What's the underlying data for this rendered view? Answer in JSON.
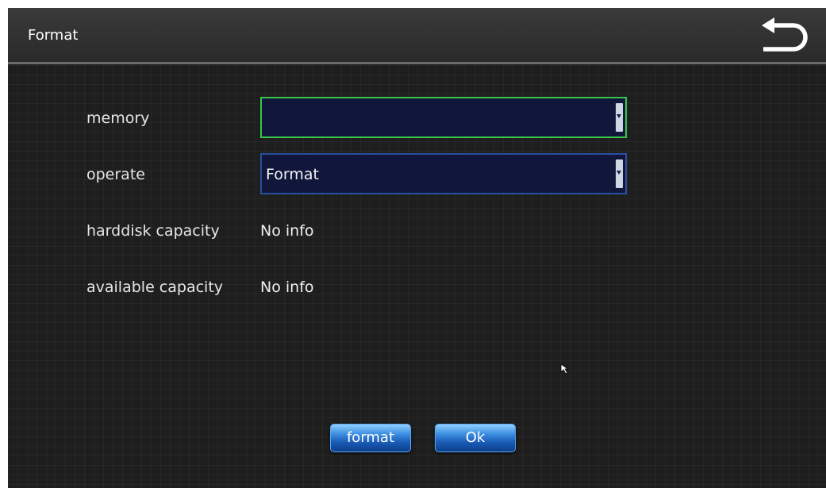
{
  "header": {
    "title": "Format"
  },
  "form": {
    "memory": {
      "label": "memory",
      "value": ""
    },
    "operate": {
      "label": "operate",
      "value": "Format"
    },
    "harddisk_capacity": {
      "label": "harddisk capacity",
      "value": "No info"
    },
    "available_capacity": {
      "label": "available capacity",
      "value": "No info"
    }
  },
  "buttons": {
    "format_label": "format",
    "ok_label": "Ok"
  },
  "icons": {
    "back": "back-arrow-icon",
    "dropdown": "chevron-down-icon",
    "cursor": "mouse-cursor-icon"
  },
  "colors": {
    "focus_border": "#38c64a",
    "select_border": "#2a4f9e",
    "select_bg": "#10173a",
    "button_blue": "#1a5cb8"
  }
}
